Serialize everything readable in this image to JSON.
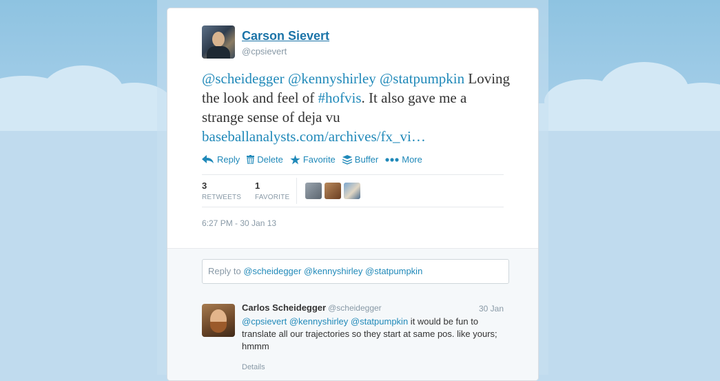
{
  "tweet": {
    "author_name": "Carson Sievert",
    "author_handle": "@cpsievert",
    "mentions": [
      "@scheidegger",
      "@kennyshirley",
      "@statpumpkin"
    ],
    "text_part1": "Loving the look and feel of ",
    "hashtag": "#hofvis",
    "text_part2": ". It also gave me a strange sense of deja vu ",
    "link": "baseballanalysts.com/archives/fx_vi…",
    "timestamp": "6:27 PM - 30 Jan 13"
  },
  "actions": {
    "reply": "Reply",
    "delete": "Delete",
    "favorite": "Favorite",
    "buffer": "Buffer",
    "more": "More"
  },
  "stats": {
    "retweets_count": "3",
    "retweets_label": "RETWEETS",
    "favorites_count": "1",
    "favorites_label": "FAVORITE"
  },
  "reply_box": {
    "prefix": "Reply to ",
    "mentions": "@scheidegger @kennyshirley @statpumpkin"
  },
  "reply": {
    "author_name": "Carlos Scheidegger",
    "author_handle": "@scheidegger",
    "date": "30 Jan",
    "mentions": "@cpsievert @kennyshirley @statpumpkin",
    "text": " it would be fun to translate all our trajectories so they start at same pos. like yours; hmmm",
    "details": "Details"
  },
  "colors": {
    "link": "#2089b9",
    "name": "#1c74a8",
    "muted": "#8899a6"
  }
}
